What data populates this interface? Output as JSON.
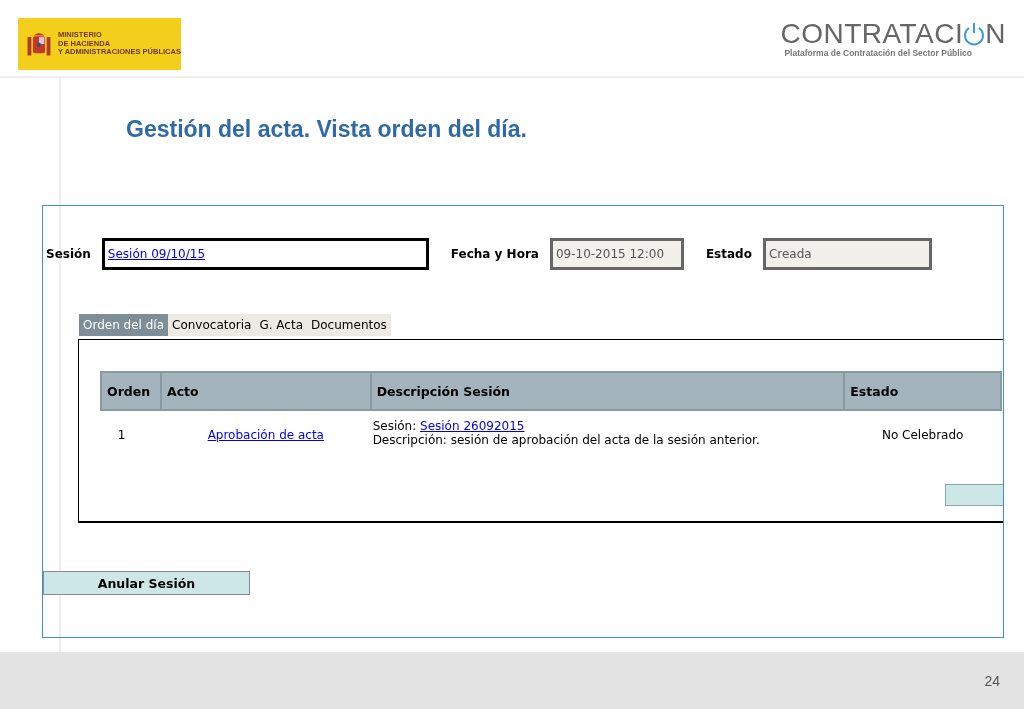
{
  "header": {
    "ministry_logo": {
      "lines": [
        "MINISTERIO",
        "DE HACIENDA",
        "Y ADMINISTRACIONES PÚBLICAS"
      ]
    },
    "brand": {
      "name_start": "CONTRATACI",
      "name_end": "N",
      "tagline": "Plataforma de Contratación del Sector Público"
    }
  },
  "slide_title": "Gestión del acta. Vista orden del día.",
  "form": {
    "fields": [
      {
        "label": "Sesión",
        "value": "Sesión 09/10/15",
        "kind": "link"
      },
      {
        "label": "Fecha y Hora",
        "value": "09-10-2015 12:00",
        "kind": "readonly"
      },
      {
        "label": "Estado",
        "value": "Creada",
        "kind": "readonly"
      }
    ]
  },
  "tabs": [
    {
      "label": "Orden del día",
      "selected": true
    },
    {
      "label": "Convocatoria",
      "selected": false
    },
    {
      "label": "G. Acta",
      "selected": false
    },
    {
      "label": "Documentos",
      "selected": false
    }
  ],
  "table": {
    "columns": [
      "Orden",
      "Acto",
      "Descripción Sesión",
      "Estado"
    ],
    "rows": [
      {
        "orden": "1",
        "acto": "Aprobación de acta",
        "session_prefix": "Sesión: ",
        "session_link": "Sesión 26092015",
        "description": "Descripción: sesión de aprobación del acta de la sesión anterior.",
        "estado": "No Celebrado"
      }
    ]
  },
  "action_button": "Anular Sesión",
  "page_number": "24"
}
